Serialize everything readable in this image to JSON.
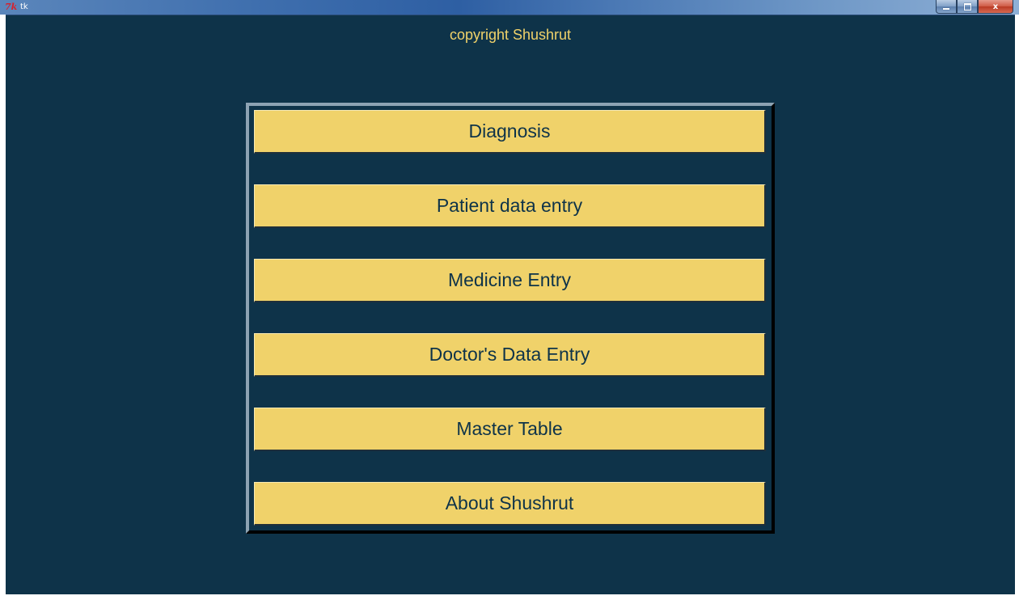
{
  "window": {
    "title": "tk",
    "logo_text": "7k",
    "close_glyph": "x"
  },
  "colors": {
    "background": "#0e3349",
    "accent": "#f0d26a"
  },
  "copyright": "copyright Shushrut",
  "menu": {
    "buttons": [
      {
        "label": "Diagnosis"
      },
      {
        "label": "Patient data entry"
      },
      {
        "label": "Medicine Entry"
      },
      {
        "label": "Doctor's Data Entry"
      },
      {
        "label": "Master Table"
      },
      {
        "label": "About Shushrut"
      }
    ]
  }
}
